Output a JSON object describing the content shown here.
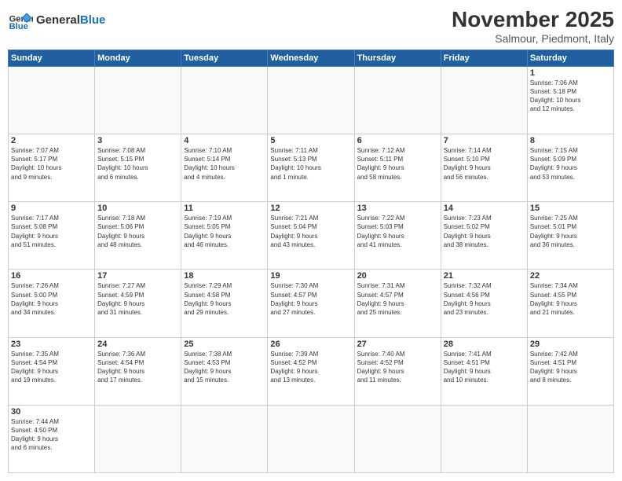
{
  "logo": {
    "text_general": "General",
    "text_blue": "Blue"
  },
  "header": {
    "title": "November 2025",
    "subtitle": "Salmour, Piedmont, Italy"
  },
  "weekdays": [
    "Sunday",
    "Monday",
    "Tuesday",
    "Wednesday",
    "Thursday",
    "Friday",
    "Saturday"
  ],
  "weeks": [
    [
      {
        "day": "",
        "info": ""
      },
      {
        "day": "",
        "info": ""
      },
      {
        "day": "",
        "info": ""
      },
      {
        "day": "",
        "info": ""
      },
      {
        "day": "",
        "info": ""
      },
      {
        "day": "",
        "info": ""
      },
      {
        "day": "1",
        "info": "Sunrise: 7:06 AM\nSunset: 5:18 PM\nDaylight: 10 hours\nand 12 minutes."
      }
    ],
    [
      {
        "day": "2",
        "info": "Sunrise: 7:07 AM\nSunset: 5:17 PM\nDaylight: 10 hours\nand 9 minutes."
      },
      {
        "day": "3",
        "info": "Sunrise: 7:08 AM\nSunset: 5:15 PM\nDaylight: 10 hours\nand 6 minutes."
      },
      {
        "day": "4",
        "info": "Sunrise: 7:10 AM\nSunset: 5:14 PM\nDaylight: 10 hours\nand 4 minutes."
      },
      {
        "day": "5",
        "info": "Sunrise: 7:11 AM\nSunset: 5:13 PM\nDaylight: 10 hours\nand 1 minute."
      },
      {
        "day": "6",
        "info": "Sunrise: 7:12 AM\nSunset: 5:11 PM\nDaylight: 9 hours\nand 58 minutes."
      },
      {
        "day": "7",
        "info": "Sunrise: 7:14 AM\nSunset: 5:10 PM\nDaylight: 9 hours\nand 56 minutes."
      },
      {
        "day": "8",
        "info": "Sunrise: 7:15 AM\nSunset: 5:09 PM\nDaylight: 9 hours\nand 53 minutes."
      }
    ],
    [
      {
        "day": "9",
        "info": "Sunrise: 7:17 AM\nSunset: 5:08 PM\nDaylight: 9 hours\nand 51 minutes."
      },
      {
        "day": "10",
        "info": "Sunrise: 7:18 AM\nSunset: 5:06 PM\nDaylight: 9 hours\nand 48 minutes."
      },
      {
        "day": "11",
        "info": "Sunrise: 7:19 AM\nSunset: 5:05 PM\nDaylight: 9 hours\nand 46 minutes."
      },
      {
        "day": "12",
        "info": "Sunrise: 7:21 AM\nSunset: 5:04 PM\nDaylight: 9 hours\nand 43 minutes."
      },
      {
        "day": "13",
        "info": "Sunrise: 7:22 AM\nSunset: 5:03 PM\nDaylight: 9 hours\nand 41 minutes."
      },
      {
        "day": "14",
        "info": "Sunrise: 7:23 AM\nSunset: 5:02 PM\nDaylight: 9 hours\nand 38 minutes."
      },
      {
        "day": "15",
        "info": "Sunrise: 7:25 AM\nSunset: 5:01 PM\nDaylight: 9 hours\nand 36 minutes."
      }
    ],
    [
      {
        "day": "16",
        "info": "Sunrise: 7:26 AM\nSunset: 5:00 PM\nDaylight: 9 hours\nand 34 minutes."
      },
      {
        "day": "17",
        "info": "Sunrise: 7:27 AM\nSunset: 4:59 PM\nDaylight: 9 hours\nand 31 minutes."
      },
      {
        "day": "18",
        "info": "Sunrise: 7:29 AM\nSunset: 4:58 PM\nDaylight: 9 hours\nand 29 minutes."
      },
      {
        "day": "19",
        "info": "Sunrise: 7:30 AM\nSunset: 4:57 PM\nDaylight: 9 hours\nand 27 minutes."
      },
      {
        "day": "20",
        "info": "Sunrise: 7:31 AM\nSunset: 4:57 PM\nDaylight: 9 hours\nand 25 minutes."
      },
      {
        "day": "21",
        "info": "Sunrise: 7:32 AM\nSunset: 4:56 PM\nDaylight: 9 hours\nand 23 minutes."
      },
      {
        "day": "22",
        "info": "Sunrise: 7:34 AM\nSunset: 4:55 PM\nDaylight: 9 hours\nand 21 minutes."
      }
    ],
    [
      {
        "day": "23",
        "info": "Sunrise: 7:35 AM\nSunset: 4:54 PM\nDaylight: 9 hours\nand 19 minutes."
      },
      {
        "day": "24",
        "info": "Sunrise: 7:36 AM\nSunset: 4:54 PM\nDaylight: 9 hours\nand 17 minutes."
      },
      {
        "day": "25",
        "info": "Sunrise: 7:38 AM\nSunset: 4:53 PM\nDaylight: 9 hours\nand 15 minutes."
      },
      {
        "day": "26",
        "info": "Sunrise: 7:39 AM\nSunset: 4:52 PM\nDaylight: 9 hours\nand 13 minutes."
      },
      {
        "day": "27",
        "info": "Sunrise: 7:40 AM\nSunset: 4:52 PM\nDaylight: 9 hours\nand 11 minutes."
      },
      {
        "day": "28",
        "info": "Sunrise: 7:41 AM\nSunset: 4:51 PM\nDaylight: 9 hours\nand 10 minutes."
      },
      {
        "day": "29",
        "info": "Sunrise: 7:42 AM\nSunset: 4:51 PM\nDaylight: 9 hours\nand 8 minutes."
      }
    ],
    [
      {
        "day": "30",
        "info": "Sunrise: 7:44 AM\nSunset: 4:50 PM\nDaylight: 9 hours\nand 6 minutes."
      },
      {
        "day": "",
        "info": ""
      },
      {
        "day": "",
        "info": ""
      },
      {
        "day": "",
        "info": ""
      },
      {
        "day": "",
        "info": ""
      },
      {
        "day": "",
        "info": ""
      },
      {
        "day": "",
        "info": ""
      }
    ]
  ]
}
